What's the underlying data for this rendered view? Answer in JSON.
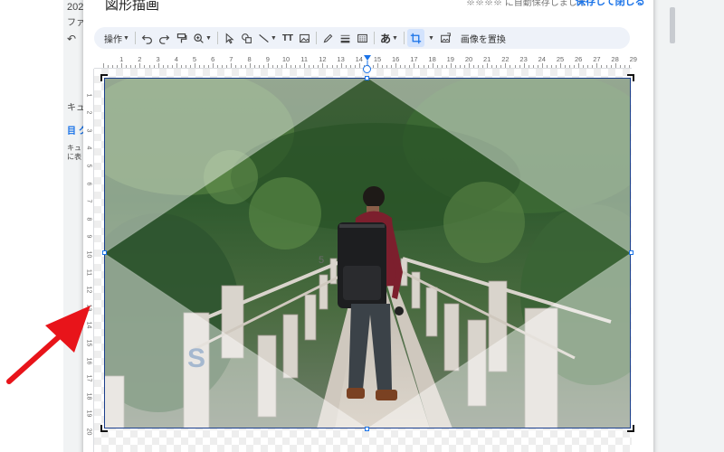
{
  "background": {
    "doc_title": "202",
    "menu_fragment": "ファ",
    "undo_glyph": "↶",
    "side_items": [
      "キュ",
      "目 ク",
      "キュ",
      "に表"
    ]
  },
  "dialog": {
    "title": "図形描画",
    "save_status": "※※※※ に自動保存しました",
    "save_close_label": "保存して閉じる"
  },
  "toolbar": {
    "actions_label": "操作",
    "replace_image_label": "画像を置換",
    "text_style_label": "あ",
    "textbox_label": "TT"
  },
  "ruler": {
    "h_numbers": [
      "1",
      "2",
      "3",
      "4",
      "5",
      "6",
      "7",
      "8",
      "9",
      "10",
      "11",
      "12",
      "13",
      "14",
      "15",
      "16",
      "17",
      "18",
      "19",
      "20",
      "21",
      "22",
      "23",
      "24",
      "25",
      "26",
      "27",
      "28",
      "29"
    ],
    "v_numbers": [
      "1",
      "2",
      "3",
      "4",
      "5",
      "6",
      "7",
      "8",
      "9",
      "10",
      "11",
      "12",
      "13",
      "14",
      "15",
      "16",
      "17",
      "18",
      "19",
      "20"
    ]
  },
  "image": {
    "graffiti_left": "S",
    "graffiti_post": "5"
  },
  "colors": {
    "accent": "#1a73e8",
    "arrow": "#e8141a",
    "selection": "#1a3e8c"
  },
  "icons": [
    "undo-icon",
    "redo-icon",
    "paint-format-icon",
    "zoom-icon",
    "select-icon",
    "shape-icon",
    "line-icon",
    "textbox-icon",
    "image-icon",
    "pen-icon",
    "border-weight-icon",
    "border-dash-icon",
    "crop-icon",
    "replace-image-icon",
    "annotation-arrow"
  ]
}
